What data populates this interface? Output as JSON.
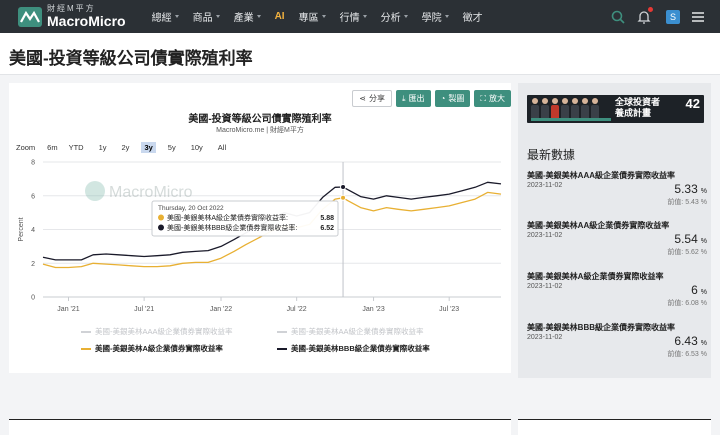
{
  "nav": {
    "logo_cn": "財經M平方",
    "logo_en": "MacroMicro",
    "menu": [
      "總經",
      "商品",
      "產業",
      "AI",
      "專區",
      "行情",
      "分析",
      "學院",
      "徵才"
    ],
    "avatar_letter": "S"
  },
  "page": {
    "title": "美國-投資等級公司債實際殖利率"
  },
  "toolbar": {
    "share": "分享",
    "export": "匯出",
    "make_chart": "製圖",
    "enlarge": "放大"
  },
  "chart_meta": {
    "subtitle": "MacroMicro.me | 財經M平方",
    "watermark": "MacroMicro",
    "zoom_label": "Zoom",
    "zoom_options": [
      "6m",
      "YTD",
      "1y",
      "2y",
      "3y",
      "5y",
      "10y",
      "All"
    ],
    "zoom_active": "3y"
  },
  "tooltip": {
    "date": "Thursday, 20 Oct 2022",
    "rows": [
      {
        "label": "美國-美銀美林A級企業債券實際收益率",
        "value": "5.88",
        "color": "#e8b033"
      },
      {
        "label": "美國-美銀美林BBB級企業債券實際收益率",
        "value": "6.52",
        "color": "#1a1a2a"
      }
    ]
  },
  "chart_data": {
    "type": "line",
    "title": "美國-投資等級公司債實際殖利率",
    "xlabel": "",
    "ylabel": "Percent",
    "ylim": [
      0,
      8
    ],
    "yticks": [
      0,
      2,
      4,
      6,
      8
    ],
    "xticks": [
      "Jan '21",
      "Jul '21",
      "Jan '22",
      "Jul '22",
      "Jan '23",
      "Jul '23"
    ],
    "xtick_dates": [
      "2021-01-01",
      "2021-07-01",
      "2022-01-01",
      "2022-07-01",
      "2023-01-01",
      "2023-07-01"
    ],
    "xlim": [
      "2020-11-01",
      "2023-11-02"
    ],
    "crosshair_date": "2022-10-20",
    "series": [
      {
        "name": "美國-美銀美林AAA級企業債券實際收益率",
        "color": "#d0d2d6",
        "visible": false
      },
      {
        "name": "美國-美銀美林AA級企業債券實際收益率",
        "color": "#d0d2d6",
        "visible": false
      },
      {
        "name": "美國-美銀美林A級企業債券實際收益率",
        "color": "#e8b033",
        "visible": true,
        "x": [
          "2020-11-01",
          "2020-12-01",
          "2021-01-01",
          "2021-02-01",
          "2021-03-01",
          "2021-04-01",
          "2021-05-01",
          "2021-06-01",
          "2021-07-01",
          "2021-08-01",
          "2021-09-01",
          "2021-10-01",
          "2021-11-01",
          "2021-12-01",
          "2022-01-01",
          "2022-02-01",
          "2022-03-01",
          "2022-04-01",
          "2022-05-01",
          "2022-06-01",
          "2022-07-01",
          "2022-08-01",
          "2022-09-01",
          "2022-10-01",
          "2022-10-20",
          "2022-11-01",
          "2022-12-01",
          "2023-01-01",
          "2023-02-01",
          "2023-03-01",
          "2023-04-01",
          "2023-05-01",
          "2023-06-01",
          "2023-07-01",
          "2023-08-01",
          "2023-09-01",
          "2023-10-01",
          "2023-11-02"
        ],
        "values": [
          1.95,
          1.75,
          1.75,
          1.8,
          2.0,
          1.95,
          1.9,
          1.85,
          1.8,
          1.8,
          1.85,
          2.0,
          2.05,
          2.05,
          2.3,
          2.7,
          3.1,
          3.5,
          3.9,
          4.2,
          4.1,
          4.3,
          5.2,
          5.8,
          5.88,
          5.7,
          5.3,
          5.1,
          5.3,
          5.2,
          5.1,
          5.2,
          5.3,
          5.4,
          5.6,
          5.8,
          6.2,
          6.1
        ]
      },
      {
        "name": "美國-美銀美林BBB級企業債券實際收益率",
        "color": "#1a1a2a",
        "visible": true,
        "x": [
          "2020-11-01",
          "2020-12-01",
          "2021-01-01",
          "2021-02-01",
          "2021-03-01",
          "2021-04-01",
          "2021-05-01",
          "2021-06-01",
          "2021-07-01",
          "2021-08-01",
          "2021-09-01",
          "2021-10-01",
          "2021-11-01",
          "2021-12-01",
          "2022-01-01",
          "2022-02-01",
          "2022-03-01",
          "2022-04-01",
          "2022-05-01",
          "2022-06-01",
          "2022-07-01",
          "2022-08-01",
          "2022-09-01",
          "2022-10-01",
          "2022-10-20",
          "2022-11-01",
          "2022-12-01",
          "2023-01-01",
          "2023-02-01",
          "2023-03-01",
          "2023-04-01",
          "2023-05-01",
          "2023-06-01",
          "2023-07-01",
          "2023-08-01",
          "2023-09-01",
          "2023-10-01",
          "2023-11-02"
        ],
        "values": [
          2.35,
          2.2,
          2.2,
          2.2,
          2.5,
          2.55,
          2.5,
          2.45,
          2.4,
          2.45,
          2.5,
          2.65,
          2.7,
          2.75,
          3.0,
          3.4,
          3.8,
          4.2,
          4.6,
          5.0,
          4.8,
          5.0,
          5.9,
          6.5,
          6.52,
          6.35,
          5.95,
          5.8,
          6.0,
          5.9,
          5.8,
          5.9,
          6.0,
          6.1,
          6.3,
          6.5,
          6.8,
          6.7
        ]
      }
    ]
  },
  "sidebar": {
    "ad_line1": "全球投資者",
    "ad_line2": "養成計畫",
    "ad_number": "42",
    "title": "最新數據",
    "stats": [
      {
        "name": "美國-美銀美林AAA級企業債券實際收益率",
        "date": "2023-11-02",
        "value": "5.33",
        "unit": "%",
        "prev": "前值: 5.43 %"
      },
      {
        "name": "美國-美銀美林AA級企業債券實際收益率",
        "date": "2023-11-02",
        "value": "5.54",
        "unit": "%",
        "prev": "前值: 5.62 %"
      },
      {
        "name": "美國-美銀美林A級企業債券實際收益率",
        "date": "2023-11-02",
        "value": "6",
        "unit": "%",
        "prev": "前值: 6.08 %"
      },
      {
        "name": "美國-美銀美林BBB級企業債券實際收益率",
        "date": "2023-11-02",
        "value": "6.43",
        "unit": "%",
        "prev": "前值: 6.53 %"
      }
    ]
  }
}
